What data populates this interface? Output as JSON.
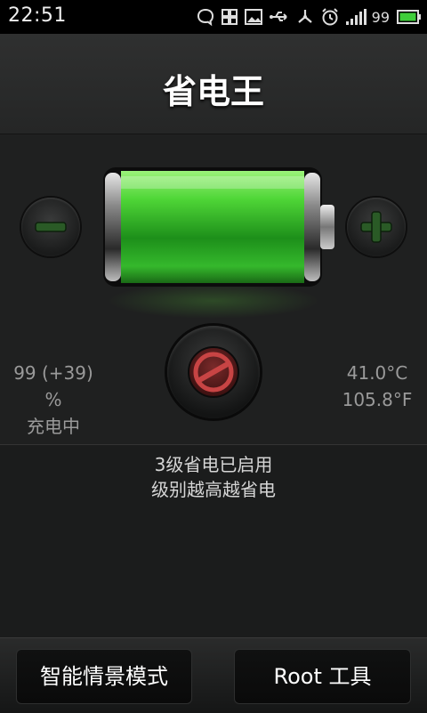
{
  "status_bar": {
    "time": "22:51",
    "battery_percent": "99",
    "icons": [
      "chat-bubble-icon",
      "grid-icon",
      "image-icon",
      "usb-icon",
      "share-icon",
      "alarm-clock-icon",
      "signal-icon",
      "battery-icon"
    ],
    "battery_color": "#3fce3a"
  },
  "header": {
    "title": "省电王"
  },
  "battery": {
    "level": 0.99,
    "accent": "#3bc42c"
  },
  "left_stat": {
    "percent": "99 (+39) %",
    "status": "充电中"
  },
  "right_stat": {
    "celsius": "41.0°C",
    "fahrenheit": "105.8°F"
  },
  "message": {
    "line1": "3级省电已启用",
    "line2": "级别越高越省电"
  },
  "bottom": {
    "smart_mode_label": "智能情景模式",
    "root_tools_label": "Root 工具"
  }
}
